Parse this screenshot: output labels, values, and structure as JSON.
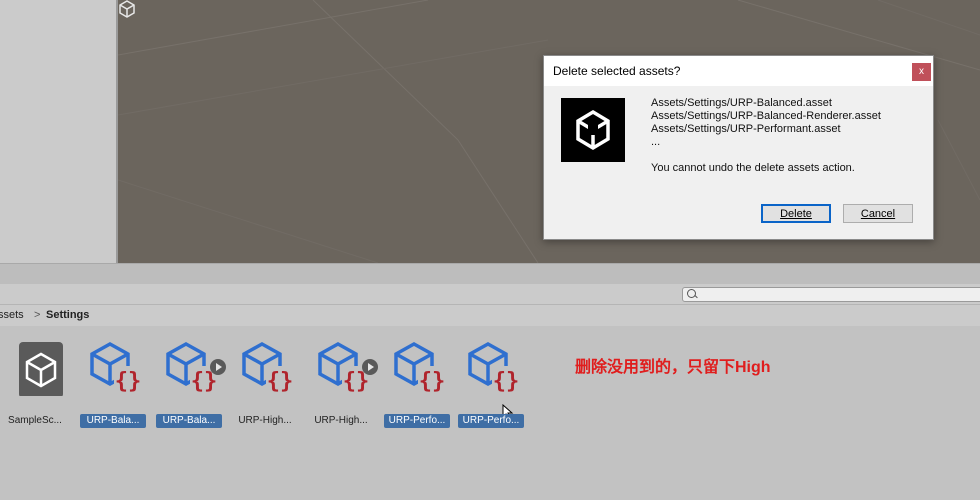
{
  "dialog": {
    "title": "Delete selected assets?",
    "close_label": "x",
    "asset_lines": [
      "Assets/Settings/URP-Balanced.asset",
      "Assets/Settings/URP-Balanced-Renderer.asset",
      "Assets/Settings/URP-Performant.asset",
      "..."
    ],
    "warning": "You cannot undo the delete assets action.",
    "delete_label": "Delete",
    "cancel_label": "Cancel"
  },
  "breadcrumb": {
    "items": [
      "ssets",
      "Settings"
    ],
    "separator": ">"
  },
  "search": {
    "placeholder": ""
  },
  "assets": [
    {
      "label": "SampleSc...",
      "icon": "scene-icon",
      "selected": false
    },
    {
      "label": "URP-Bala...",
      "icon": "urp-asset-icon",
      "selected": true
    },
    {
      "label": "URP-Bala...",
      "icon": "urp-asset-icon",
      "selected": true
    },
    {
      "label": "URP-High...",
      "icon": "urp-asset-icon",
      "selected": false
    },
    {
      "label": "URP-High...",
      "icon": "urp-asset-icon",
      "selected": false
    },
    {
      "label": "URP-Perfo...",
      "icon": "urp-asset-icon",
      "selected": true
    },
    {
      "label": "URP-Perfo...",
      "icon": "urp-asset-icon",
      "selected": true
    }
  ],
  "annotation": "删除没用到的，只留下High",
  "colors": {
    "selection": "#3f6ea5",
    "annotation": "#e01d1d",
    "asset_blue": "#2f6fcf",
    "asset_red": "#b0242c"
  }
}
